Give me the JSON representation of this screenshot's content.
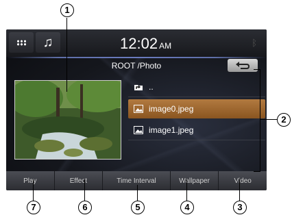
{
  "header": {
    "time": "12:02",
    "ampm": "AM"
  },
  "path": "ROOT /Photo",
  "list": [
    {
      "label": "..",
      "icon": "folder-up-icon"
    },
    {
      "label": "image0.jpeg",
      "icon": "image-icon",
      "selected": true
    },
    {
      "label": "image1.jpeg",
      "icon": "image-icon"
    }
  ],
  "bottom_buttons": [
    "Play",
    "Effect",
    "Time Interval",
    "Wallpaper",
    "Video"
  ],
  "callouts": [
    "1",
    "2",
    "3",
    "4",
    "5",
    "6",
    "7"
  ],
  "colors": {
    "selected_row": "#a86a2e",
    "bar": "#3d3f45",
    "accent_line": "#6a7bbf"
  }
}
